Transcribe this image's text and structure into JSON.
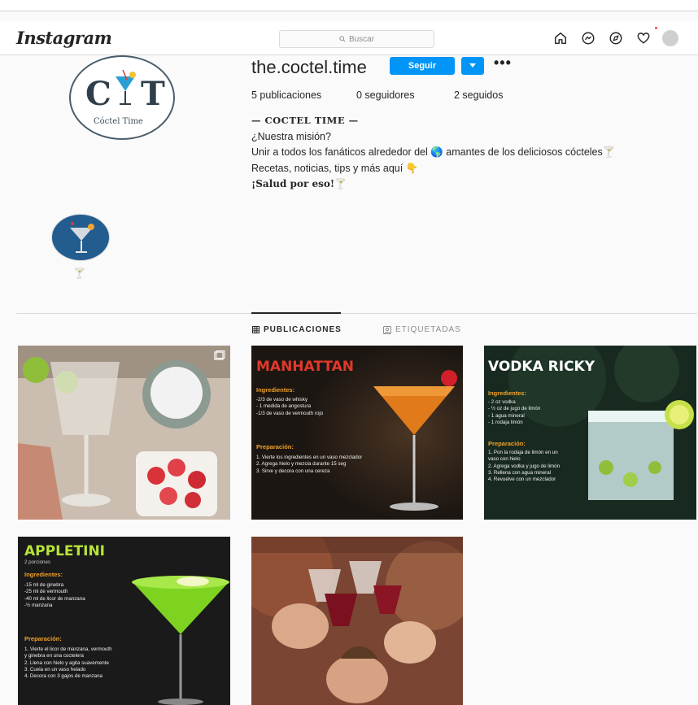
{
  "app": {
    "logo": "Instagram"
  },
  "search": {
    "placeholder": "Buscar"
  },
  "nav": {
    "icons": [
      "home-icon",
      "messenger-icon",
      "explore-icon",
      "heart-icon",
      "profile-avatar"
    ]
  },
  "profile": {
    "pic_letters": {
      "left": "C",
      "right": "T"
    },
    "pic_subtitle": "Cóctel Time",
    "username": "the.coctel.time",
    "follow_label": "Seguir",
    "more_label": "•••",
    "stats": {
      "posts": "5 publicaciones",
      "followers": "0 seguidores",
      "following": "2 seguidos"
    },
    "bio": {
      "name": "— COCTEL TIME —",
      "line1": "¿Nuestra misión?",
      "line2": "Unir a todos los fanáticos alrededor del 🌎 amantes de los deliciosos cócteles🍸",
      "line3": "Recetas, noticias, tips y más aquí 👇",
      "line4": "¡Salud por eso!🍸"
    },
    "highlight_label": "🍸"
  },
  "tabs": {
    "posts": "PUBLICACIONES",
    "tagged": "ETIQUETADAS"
  },
  "posts": [
    {
      "type": "photo",
      "subject": "cocktail glasses with lime and strawberries"
    },
    {
      "title": "MANHATTAN",
      "ing_head": "Ingredientes:",
      "ingredients": "-2/3 de vaso de whisky\n- 1 medida de angostura\n-1/3 de vaso de vermouth rojo",
      "prep_head": "Preparación:",
      "prep": "1. Vierte los ingredientes en un vaso mezclador\n2. Agrega hielo y mezcla durante 15 seg\n3. Sirve y decora con una cereza"
    },
    {
      "title": "VODKA RICKY",
      "ing_head": "Ingredientes:",
      "ingredients": "- 2 oz vodka\n- ½ oz de jugo de limón\n- 1 agua mineral\n- 1 rodaja limón",
      "prep_head": "Preparación:",
      "prep": "1. Pon la rodaja de limón en un\nvaso con hielo\n2. Agrega vodka y jugo de limón\n3. Rellena con agua mineral\n4. Revuelve con un mezclador"
    },
    {
      "title": "APPLETINI",
      "subtitle": "2 porciones",
      "ing_head": "Ingredientes:",
      "ingredients": "-15 ml de ginebra\n-25 ml de vermouth\n-40 ml de licor de manzana\n-½ manzana",
      "prep_head": "Preparación:",
      "prep": "1. Vierte el licor de manzana, vermouth\ny ginebra en una coctelera\n2. Llena con hielo y agita suavemente\n3. Cuela en un vaso helado\n4. Decora con 3 gajos de manzana"
    },
    {
      "type": "photo",
      "subject": "friends toasting with wine"
    }
  ],
  "colors": {
    "accent": "#0095f6",
    "manhattan_title": "#e0392b",
    "vodka_title": "#ffffff",
    "appletini_title": "#b7e33a",
    "section_head": "#f0a12a"
  }
}
